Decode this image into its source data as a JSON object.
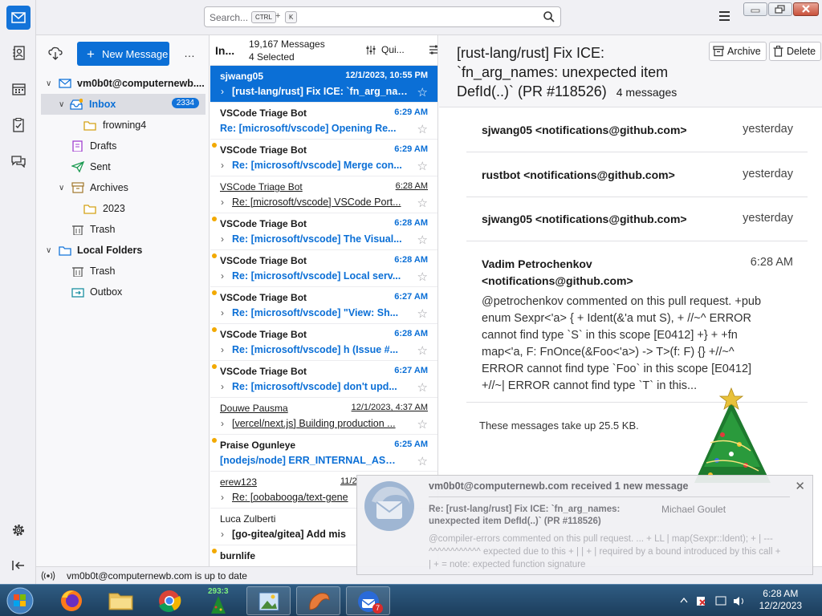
{
  "search": {
    "placeholder": "Search...",
    "kbd1": "CTRL",
    "plus": "+",
    "kbd2": "K"
  },
  "folder_pane": {
    "new_message": "New Message",
    "more": "…",
    "items": [
      {
        "label": "vm0b0t@computernewb...."
      },
      {
        "label": "Inbox",
        "badge": "2334"
      },
      {
        "label": "frowning4"
      },
      {
        "label": "Drafts"
      },
      {
        "label": "Sent"
      },
      {
        "label": "Archives"
      },
      {
        "label": "2023"
      },
      {
        "label": "Trash"
      },
      {
        "label": "Local Folders"
      },
      {
        "label": "Trash"
      },
      {
        "label": "Outbox"
      }
    ]
  },
  "message_list": {
    "folder": "In...",
    "count_line1": "19,167 Messages",
    "count_line2": "4 Selected",
    "quick_filter": "Qui...",
    "messages": [
      {
        "sender": "sjwang05",
        "date": "12/1/2023, 10:55 PM",
        "subject": "[rust-lang/rust] Fix ICE: `fn_arg_names: unexpected item DefId(..)`"
      },
      {
        "sender": "VSCode Triage Bot",
        "date": "6:29 AM",
        "subject": "Re: [microsoft/vscode] Opening Re..."
      },
      {
        "sender": "VSCode Triage Bot",
        "date": "6:29 AM",
        "subject": "Re: [microsoft/vscode] Merge con..."
      },
      {
        "sender": "VSCode Triage Bot",
        "date": "6:28 AM",
        "subject": "Re: [microsoft/vscode] VSCode Port..."
      },
      {
        "sender": "VSCode Triage Bot",
        "date": "6:28 AM",
        "subject": "Re: [microsoft/vscode] The Visual..."
      },
      {
        "sender": "VSCode Triage Bot",
        "date": "6:28 AM",
        "subject": "Re: [microsoft/vscode] Local serv..."
      },
      {
        "sender": "VSCode Triage Bot",
        "date": "6:27 AM",
        "subject": "Re: [microsoft/vscode] \"View: Sh..."
      },
      {
        "sender": "VSCode Triage Bot",
        "date": "6:28 AM",
        "subject": "Re: [microsoft/vscode] h (Issue #..."
      },
      {
        "sender": "VSCode Triage Bot",
        "date": "6:27 AM",
        "subject": "Re: [microsoft/vscode] don't upd..."
      },
      {
        "sender": "Douwe Pausma",
        "date": "12/1/2023, 4:37 AM",
        "subject": "[vercel/next.js] Building production ..."
      },
      {
        "sender": "Praise Ogunleye",
        "date": "6:25 AM",
        "subject": "[nodejs/node] ERR_INTERNAL_ASSE..."
      },
      {
        "sender": "erew123",
        "date": "11/2",
        "subject": "Re: [oobabooga/text-gene"
      },
      {
        "sender": "Luca Zulberti",
        "date": "",
        "subject": "[go-gitea/gitea] Add mis"
      },
      {
        "sender": "burnlife",
        "date": "",
        "subject": ""
      }
    ]
  },
  "reader": {
    "title": "[rust-lang/rust] Fix ICE: `fn_arg_names: unexpected item DefId(..)` (PR #118526)",
    "count": "4 messages",
    "archive": "Archive",
    "delete": "Delete",
    "conversation": [
      {
        "from": "sjwang05 <notifications@github.com>",
        "when": "yesterday"
      },
      {
        "from": "rustbot <notifications@github.com>",
        "when": "yesterday"
      },
      {
        "from": "sjwang05 <notifications@github.com>",
        "when": "yesterday"
      },
      {
        "from": "Vadim Petrochenkov <notifications@github.com>",
        "when": "6:28 AM",
        "body": "@petrochenkov commented on this pull request. +pub enum Sexpr<'a> { + Ident(&'a mut S), + //~^ ERROR cannot find type `S` in this scope [E0412] +} + +fn map<'a, F: FnOnce(&Foo<'a>) -> T>(f: F) {} +//~^ ERROR cannot find type `Foo` in this scope [E0412] +//~| ERROR cannot find type `T` in this..."
      }
    ],
    "footer": "These messages take up 25.5 KB."
  },
  "status": "vm0b0t@computernewb.com is up to date",
  "notification": {
    "title": "vm0b0t@computernewb.com received 1 new message",
    "subject": "Re: [rust-lang/rust] Fix ICE: `fn_arg_names: unexpected item DefId(..)` (PR #118526)",
    "author": "Michael Goulet",
    "snippet": "@compiler-errors commented on this pull request. ... + LL | map(Sexpr::Ident); + | --- ^^^^^^^^^^^^ expected due to this + | | + | required by a bound introduced by this call + | + = note: expected function signature"
  },
  "taskbar": {
    "tree_counter": "293:3",
    "thunderbird_badge": "7",
    "time": "6:28 AM",
    "date": "12/2/2023"
  },
  "colors": {
    "accent": "#0b6fd6",
    "unread_dot": "#f2a900",
    "badge": "#1373d9"
  }
}
